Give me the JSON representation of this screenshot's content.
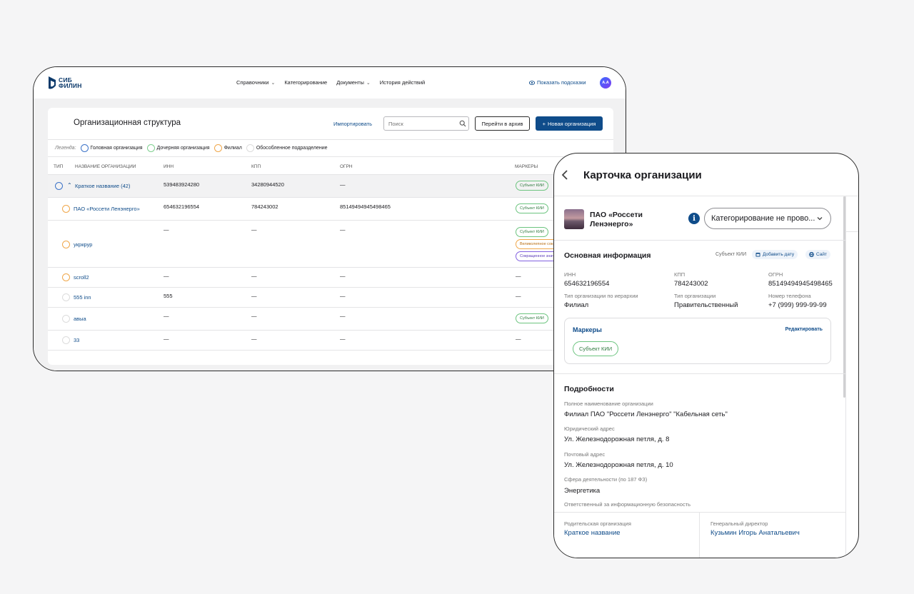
{
  "app": {
    "logo_line1": "СИБ",
    "logo_line2": "ФИЛИН",
    "nav": [
      {
        "label": "Справочники",
        "has_dropdown": true
      },
      {
        "label": "Категорирование",
        "has_dropdown": false
      },
      {
        "label": "Документы",
        "has_dropdown": true
      },
      {
        "label": "История действий",
        "has_dropdown": false
      }
    ],
    "hints_label": "Показать подсказки",
    "avatar_initials": "А.А"
  },
  "list": {
    "title": "Организационная структура",
    "import_label": "Импортировать",
    "search_placeholder": "Поиск",
    "archive_label": "Перейти в архив",
    "new_org_label": "Новая организация",
    "legend_label": "Легенда:",
    "legend": [
      {
        "label": "Головная организация",
        "color": "#3c73c8"
      },
      {
        "label": "Дочерняя организация",
        "color": "#7fcf8f"
      },
      {
        "label": "Филиал",
        "color": "#f0a74a"
      },
      {
        "label": "Обособленное подразделение",
        "color": "#dcdcdc"
      }
    ],
    "columns": [
      "Тип",
      "Название организации",
      "ИНН",
      "КПП",
      "ОГРН",
      "Маркеры"
    ],
    "rows": [
      {
        "name": "Краткое название (42)",
        "inn": "539483924280",
        "kpp": "34280944520",
        "ogrn": "—",
        "type": "head",
        "expanded": true,
        "markers": [
          "Субъект КИИ"
        ]
      },
      {
        "name": "ПАО «Россети Ленэнерго»",
        "inn": "654632196554",
        "kpp": "784243002",
        "ogrn": "85149494945498465",
        "type": "branch",
        "markers": [
          "Субъект КИИ"
        ]
      },
      {
        "name": "укркрур",
        "inn": "—",
        "kpp": "—",
        "ogrn": "—",
        "type": "branch",
        "markers": [
          "Субъект КИИ",
          "Великолепное сокр",
          "Сокращенное значе"
        ]
      },
      {
        "name": "scroll2",
        "inn": "—",
        "kpp": "—",
        "ogrn": "—",
        "type": "branch",
        "markers_text": "—"
      },
      {
        "name": "555 inn",
        "inn": "555",
        "kpp": "—",
        "ogrn": "—",
        "type": "separate",
        "markers_text": "—"
      },
      {
        "name": "авыа",
        "inn": "—",
        "kpp": "—",
        "ogrn": "—",
        "type": "separate",
        "markers": [
          "Субъект КИИ"
        ]
      },
      {
        "name": "33",
        "inn": "—",
        "kpp": "—",
        "ogrn": "—",
        "type": "separate",
        "markers_text": "—"
      }
    ]
  },
  "card": {
    "title": "Карточка организации",
    "org_name_line1": "ПАО «Россети",
    "org_name_line2": "Ленэнерго»",
    "category_value": "Категорирование не прово...",
    "main_info_title": "Основная информация",
    "kii_label": "Субъект КИИ",
    "add_date_label": "Добавить дату",
    "site_label": "Сайт",
    "fields": {
      "inn_label": "ИНН",
      "inn": "654632196554",
      "kpp_label": "КПП",
      "kpp": "784243002",
      "ogrn_label": "ОГРН",
      "ogrn": "85149494945498465",
      "hier_label": "Тип организации по иерархии",
      "hier": "Филиал",
      "org_type_label": "Тип организации",
      "org_type": "Правительственный",
      "phone_label": "Номер телефона",
      "phone": "+7 (999) 999-99-99"
    },
    "markers_title": "Маркеры",
    "edit_label": "Редактировать",
    "marker": "Субъект КИИ",
    "details_title": "Подробности",
    "details": {
      "full_name_label": "Полное наименование организации",
      "full_name": "Филиал ПАО \"Россети Ленэнерго\" \"Кабельная сеть\"",
      "legal_addr_label": "Юридический адрес",
      "legal_addr": "Ул. Железнодорожная петля, д. 8",
      "post_addr_label": "Почтовый адрес",
      "post_addr": "Ул. Железнодорожная петля, д. 10",
      "sphere_label": "Сфера деятельности (по 187 ФЗ)",
      "sphere": "Энергетика",
      "resp_label": "Ответственный за информационную безопасность"
    },
    "footer": {
      "parent_label": "Родительская организация",
      "parent": "Краткое название",
      "director_label": "Генеральный директор",
      "director": "Кузьмин Игорь Анатальевич"
    }
  }
}
